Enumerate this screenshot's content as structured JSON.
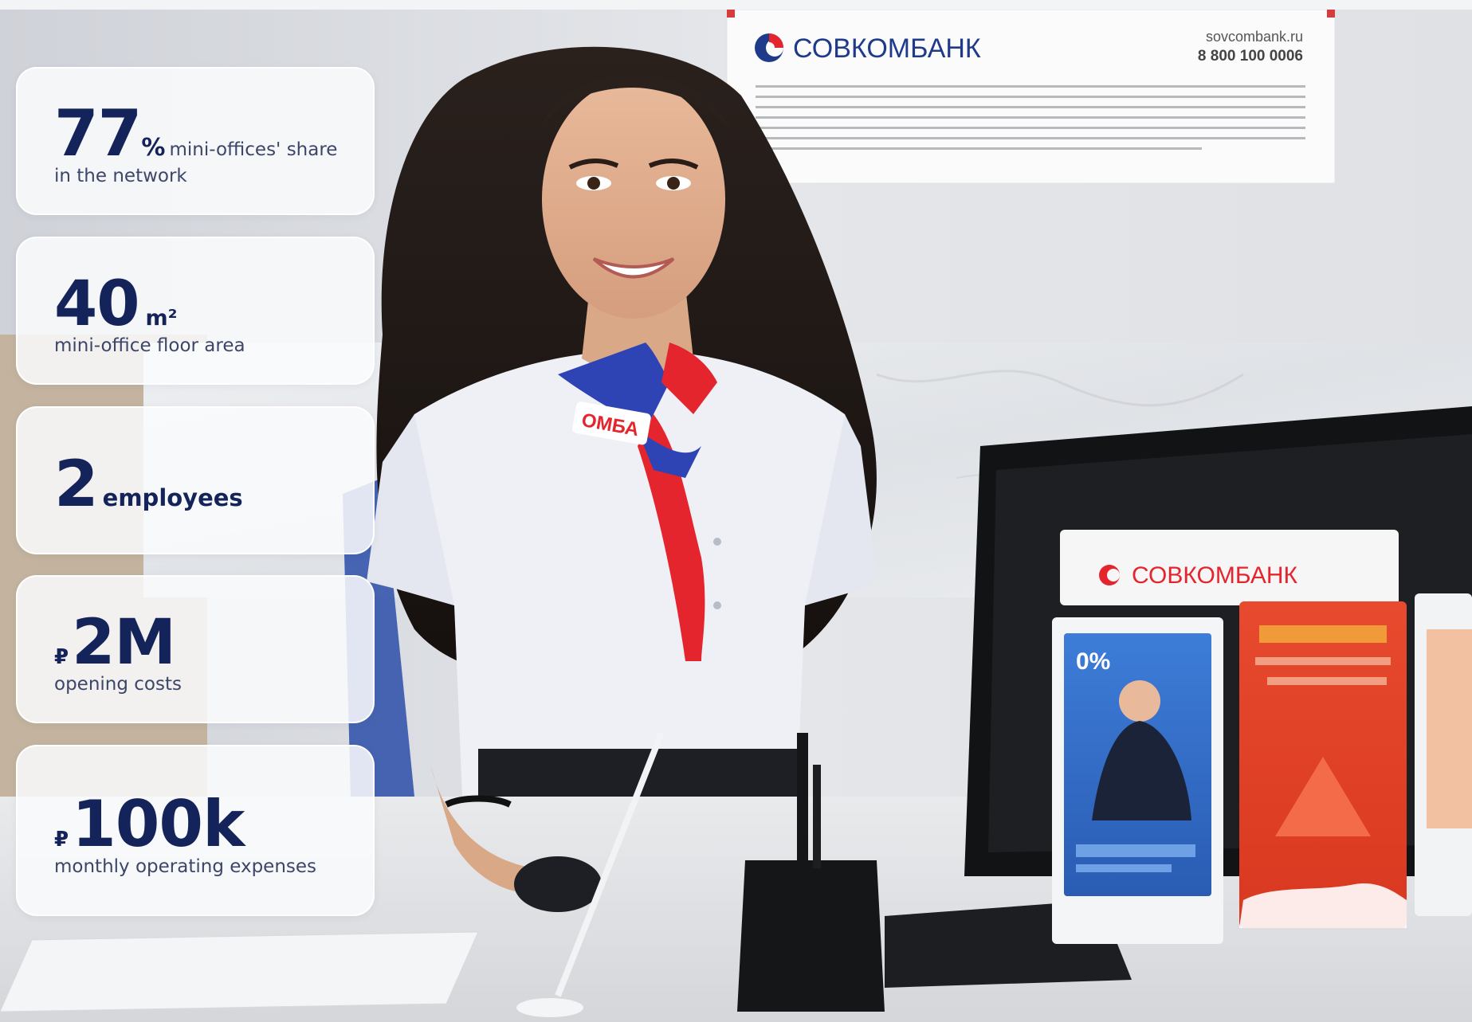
{
  "stats": [
    {
      "value": "77",
      "unit": "%",
      "caption": "mini-offices' share in the network"
    },
    {
      "value": "40",
      "unit": "m²",
      "caption": "mini-office floor area"
    },
    {
      "value": "2",
      "unit": "",
      "caption": "employees"
    },
    {
      "currency": "₽",
      "value": "2M",
      "caption": "opening costs"
    },
    {
      "currency": "₽",
      "value": "100k",
      "caption": "monthly operating expenses"
    }
  ],
  "photo": {
    "sign_brand": "СОВКОМБАНК",
    "sign_site": "sovcombank.ru",
    "sign_phone": "8 800 100 0006",
    "scarf_text": "ОМБА",
    "stand_brand": "СОВКОМБАНК",
    "flyer_badge": "0%",
    "colors": {
      "brand_blue": "#1f3a8a",
      "brand_red": "#e5252e",
      "card_text": "#14245a"
    }
  }
}
